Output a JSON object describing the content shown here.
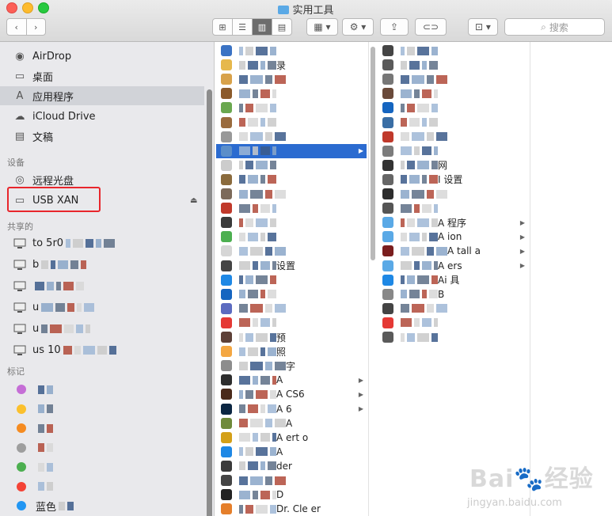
{
  "window": {
    "title": "实用工具"
  },
  "toolbar": {
    "back": "‹",
    "forward": "›",
    "views": [
      "⊞",
      "☰",
      "▥",
      "▤"
    ],
    "group_label": "▦ ▾",
    "action_label": "⚙ ▾",
    "share_label": "⇪",
    "tag_label": "⊂⊃",
    "dropbox_label": "⊡ ▾",
    "search_placeholder": "搜索",
    "search_icon": "⌕"
  },
  "sidebar": {
    "favorites": [
      {
        "label": "AirDrop",
        "icon": "airdrop-icon",
        "glyph": "◉"
      },
      {
        "label": "桌面",
        "icon": "desktop-icon",
        "glyph": "▭"
      },
      {
        "label": "应用程序",
        "icon": "applications-icon",
        "glyph": "A"
      },
      {
        "label": "iCloud Drive",
        "icon": "cloud-icon",
        "glyph": "☁"
      },
      {
        "label": "文稿",
        "icon": "documents-icon",
        "glyph": "▤"
      }
    ],
    "devices_header": "设备",
    "devices": [
      {
        "label": "远程光盘",
        "icon": "disc-icon",
        "glyph": "◎"
      },
      {
        "label": "USB XAN",
        "icon": "drive-icon",
        "glyph": "▭"
      }
    ],
    "shared_header": "共享的",
    "shared": [
      {
        "label": "to 5r0"
      },
      {
        "label": "b"
      },
      {
        "label": ""
      },
      {
        "label": "u"
      },
      {
        "label": "u"
      },
      {
        "label": "us 10"
      }
    ],
    "tags_header": "标记",
    "tags": [
      {
        "label": "",
        "color": "#c56ed6"
      },
      {
        "label": "",
        "color": "#fbc02d"
      },
      {
        "label": "",
        "color": "#f58b20"
      },
      {
        "label": "",
        "color": "#9e9e9e"
      },
      {
        "label": "",
        "color": "#4caf50"
      },
      {
        "label": "",
        "color": "#f44336"
      },
      {
        "label": "蓝色",
        "color": "#2196f3"
      }
    ],
    "eject": "⏏"
  },
  "column1": {
    "rows": [
      {
        "label": "",
        "color": "#3b73c4"
      },
      {
        "label": "录",
        "color": "#e6b84c"
      },
      {
        "label": "",
        "color": "#d8a24a"
      },
      {
        "label": "",
        "color": "#8b5a2b"
      },
      {
        "label": "",
        "color": "#6aa84f"
      },
      {
        "label": "",
        "color": "#9a6b3d"
      },
      {
        "label": "",
        "color": "#999999"
      },
      {
        "label": "",
        "color": "#5b8ec9",
        "folder": true
      },
      {
        "label": "",
        "color": "#cccccc"
      },
      {
        "label": "",
        "color": "#8b6b3d"
      },
      {
        "label": "",
        "color": "#7c6a5a"
      },
      {
        "label": "",
        "color": "#c0392b"
      },
      {
        "label": "",
        "color": "#3a3a3a"
      },
      {
        "label": "",
        "color": "#4caf50"
      },
      {
        "label": "",
        "color": "#d6d6d6"
      },
      {
        "label": "设置",
        "color": "#444444"
      },
      {
        "label": "",
        "color": "#1e88e5"
      },
      {
        "label": "",
        "color": "#1565c0"
      },
      {
        "label": "",
        "color": "#5c6bc0"
      },
      {
        "label": "",
        "color": "#e53935"
      },
      {
        "label": "预",
        "color": "#5d4037"
      },
      {
        "label": "照",
        "color": "#f4a742"
      },
      {
        "label": "字",
        "color": "#8d8d8d"
      },
      {
        "label": "A",
        "color": "#2d2d2d",
        "folder": true
      },
      {
        "label": "A CS6",
        "color": "#4a2a1a",
        "folder": true
      },
      {
        "label": "A 6",
        "color": "#0b2642",
        "folder": true
      },
      {
        "label": "A",
        "color": "#6f8a3a"
      },
      {
        "label": "A ert o",
        "color": "#d4a017"
      },
      {
        "label": "A",
        "color": "#1e88e5"
      },
      {
        "label": "der",
        "color": "#3a3a3a"
      },
      {
        "label": "",
        "color": "#444444"
      },
      {
        "label": "D",
        "color": "#222222"
      },
      {
        "label": "Dr. Cle er",
        "color": "#e57f2b"
      }
    ],
    "selected_index": 7
  },
  "column2": {
    "rows": [
      {
        "label": "",
        "color": "#444444"
      },
      {
        "label": "",
        "color": "#5a5a5a"
      },
      {
        "label": "",
        "color": "#777777"
      },
      {
        "label": "",
        "color": "#6a4a3a"
      },
      {
        "label": "",
        "color": "#1565c0"
      },
      {
        "label": "",
        "color": "#3a6ea5"
      },
      {
        "label": "",
        "color": "#c0392b"
      },
      {
        "label": "",
        "color": "#7c7c7c"
      },
      {
        "label": "网",
        "color": "#333333"
      },
      {
        "label": "I 设置",
        "color": "#666666"
      },
      {
        "label": "",
        "color": "#2d2d2d"
      },
      {
        "label": "",
        "color": "#555555"
      },
      {
        "label": "A 程序",
        "color": "#5aa9e6",
        "folder": true
      },
      {
        "label": "A ion",
        "color": "#5aa9e6",
        "folder": true
      },
      {
        "label": "A tall a",
        "color": "#7a1e1e",
        "folder": true
      },
      {
        "label": "A ers",
        "color": "#5aa9e6",
        "folder": true
      },
      {
        "label": "Ai 具",
        "color": "#1e88e5"
      },
      {
        "label": "B",
        "color": "#888888"
      },
      {
        "label": "",
        "color": "#444444"
      },
      {
        "label": "",
        "color": "#e53935"
      },
      {
        "label": "",
        "color": "#5a5a5a"
      }
    ]
  },
  "watermark": {
    "text": "Bai🐾经验",
    "url": "jingyan.baidu.com"
  }
}
